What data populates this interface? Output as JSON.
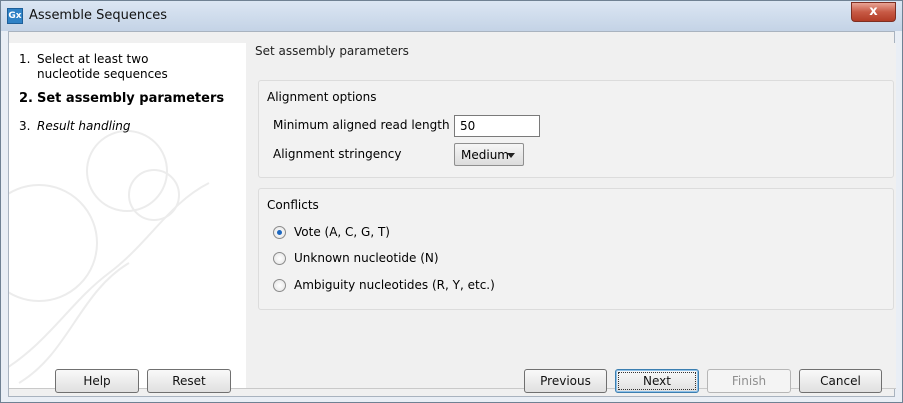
{
  "window": {
    "icon_text": "Gx",
    "title": "Assemble Sequences",
    "close_glyph": "x"
  },
  "steps": [
    {
      "number": "1.",
      "label": "Select at least two nucleotide sequences",
      "line1": "Select at least two",
      "line2": "nucleotide sequences",
      "state": "done"
    },
    {
      "number": "2.",
      "label": "Set assembly parameters",
      "state": "active"
    },
    {
      "number": "3.",
      "label": "Result handling",
      "state": "pending"
    }
  ],
  "main": {
    "heading": "Set assembly parameters",
    "alignment_options": {
      "legend": "Alignment options",
      "min_read_length_label": "Minimum aligned read length",
      "min_read_length_value": "50",
      "stringency_label": "Alignment stringency",
      "stringency_value": "Medium"
    },
    "conflicts": {
      "legend": "Conflicts",
      "options": [
        {
          "label": "Vote (A, C, G, T)",
          "checked": true
        },
        {
          "label": "Unknown nucleotide (N)",
          "checked": false
        },
        {
          "label": "Ambiguity nucleotides (R, Y, etc.)",
          "checked": false
        }
      ]
    }
  },
  "buttons": {
    "help": "Help",
    "reset": "Reset",
    "previous": "Previous",
    "next": "Next",
    "finish": "Finish",
    "cancel": "Cancel"
  },
  "colors": {
    "title_bar": "#c4d3e6",
    "close_button": "#c75a45",
    "radio_selected": "#1d68c0"
  }
}
